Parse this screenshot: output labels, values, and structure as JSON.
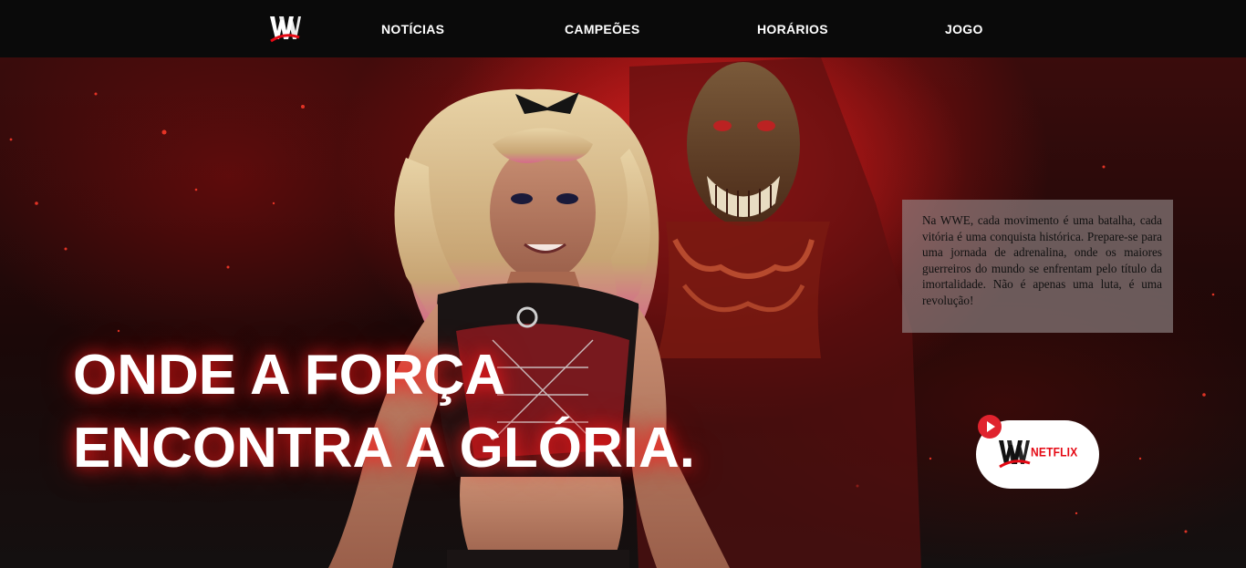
{
  "nav": {
    "logo_icon": "wwe-logo-icon",
    "items": [
      {
        "label": "NOTÍCIAS"
      },
      {
        "label": "CAMPEÕES"
      },
      {
        "label": "HORÁRIOS"
      },
      {
        "label": "JOGO"
      }
    ]
  },
  "hero": {
    "headline_line1": "ONDE A FORÇA",
    "headline_line2": "ENCONTRA A GLÓRIA.",
    "info_text": "Na WWE, cada movimento é uma batalha, cada vitória é uma conquista histórica. Prepare-se para uma jornada de adrenalina, onde os maiores guerreiros do mundo se enfrentam pelo título da imortalidade. Não é apenas uma luta, é uma revolução!",
    "badge": {
      "brand_text": "NETFLIX",
      "logo_icon": "wwe-logo-icon",
      "play_icon": "play-icon"
    }
  },
  "colors": {
    "nav_background": "#0a0a0a",
    "accent_red": "#e50914",
    "play_red": "#e0232e",
    "text_white": "#ffffff"
  }
}
